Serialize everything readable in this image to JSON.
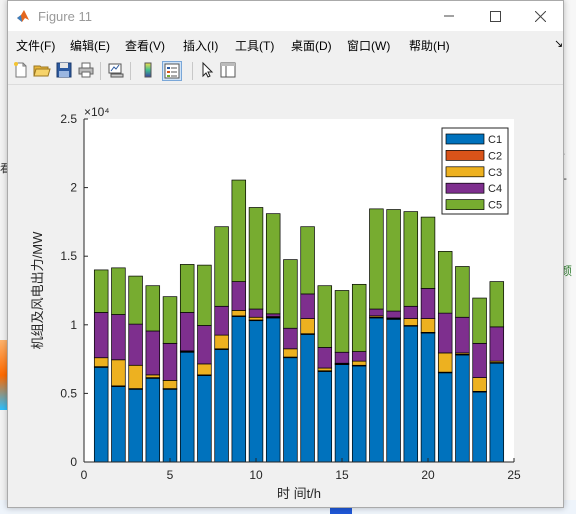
{
  "window": {
    "title": "Figure 11",
    "controls": [
      "minimize",
      "maximize",
      "close"
    ]
  },
  "menubar": {
    "items": [
      "文件(F)",
      "编辑(E)",
      "查看(V)",
      "插入(I)",
      "工具(T)",
      "桌面(D)",
      "窗口(W)",
      "帮助(H)"
    ]
  },
  "toolbar": {
    "buttons": [
      "new-figure-icon",
      "open-file-icon",
      "save-icon",
      "print-icon",
      "link-plot-icon",
      "colorbar-icon",
      "legend-icon",
      "pointer-icon",
      "property-inspector-icon"
    ]
  },
  "background": {
    "left_text": "看",
    "right_texts": [
      "*",
      "+",
      "颜"
    ]
  },
  "chart_data": {
    "type": "bar",
    "stacked": true,
    "xlabel": "时 间t/h",
    "ylabel": "机组及风电出力/MW",
    "exponent_label": "×10⁴",
    "xlim": [
      0,
      25
    ],
    "ylim": [
      0,
      2.5
    ],
    "xticks": [
      "0",
      "5",
      "10",
      "15",
      "20",
      "25"
    ],
    "yticks": [
      "0",
      "0.5",
      "1",
      "1.5",
      "2",
      "2.5"
    ],
    "grid": false,
    "legend_position": "top-right",
    "categories": [
      1,
      2,
      3,
      4,
      5,
      6,
      7,
      8,
      9,
      10,
      11,
      12,
      13,
      14,
      15,
      16,
      17,
      18,
      19,
      20,
      21,
      22,
      23,
      24
    ],
    "series": [
      {
        "name": "C1",
        "color": "#0072BD",
        "values": [
          0.69,
          0.55,
          0.53,
          0.61,
          0.53,
          0.8,
          0.63,
          0.82,
          1.06,
          1.03,
          1.05,
          0.76,
          0.93,
          0.66,
          0.71,
          0.7,
          1.05,
          1.04,
          0.99,
          0.94,
          0.65,
          0.78,
          0.51,
          0.72
        ]
      },
      {
        "name": "C2",
        "color": "#D95319",
        "values": [
          0.005,
          0.005,
          0.005,
          0.005,
          0.005,
          0.005,
          0.005,
          0.005,
          0.005,
          0.005,
          0.005,
          0.005,
          0.005,
          0.005,
          0.005,
          0.005,
          0.005,
          0.005,
          0.005,
          0.005,
          0.005,
          0.005,
          0.005,
          0.005
        ]
      },
      {
        "name": "C3",
        "color": "#EDB120",
        "values": [
          0.065,
          0.19,
          0.17,
          0.02,
          0.06,
          0.005,
          0.08,
          0.1,
          0.04,
          0.02,
          0.005,
          0.06,
          0.11,
          0.02,
          0.005,
          0.03,
          0.01,
          0.005,
          0.05,
          0.1,
          0.14,
          0.01,
          0.1,
          0.01
        ]
      },
      {
        "name": "C4",
        "color": "#7E2F8E",
        "values": [
          0.33,
          0.33,
          0.3,
          0.32,
          0.27,
          0.28,
          0.28,
          0.21,
          0.21,
          0.06,
          0.02,
          0.15,
          0.18,
          0.15,
          0.08,
          0.07,
          0.05,
          0.05,
          0.09,
          0.22,
          0.29,
          0.26,
          0.25,
          0.25
        ]
      },
      {
        "name": "C5",
        "color": "#77AC30",
        "values": [
          0.31,
          0.34,
          0.35,
          0.33,
          0.34,
          0.35,
          0.44,
          0.58,
          0.74,
          0.74,
          0.73,
          0.5,
          0.49,
          0.45,
          0.45,
          0.49,
          0.73,
          0.74,
          0.69,
          0.52,
          0.45,
          0.37,
          0.33,
          0.33
        ]
      }
    ]
  }
}
